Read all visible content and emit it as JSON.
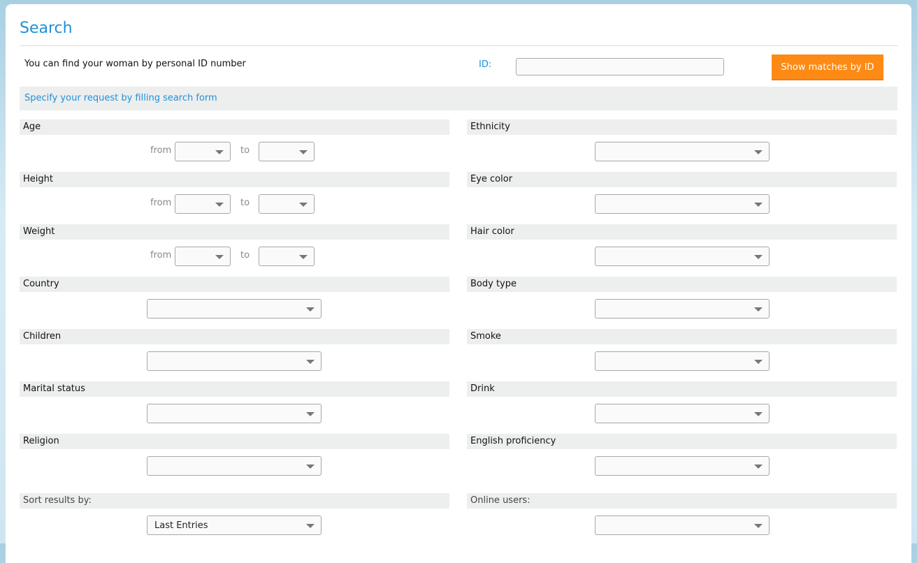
{
  "page": {
    "title": "Search"
  },
  "id_search": {
    "hint": "You can find your woman by personal ID number",
    "label": "ID:",
    "value": "",
    "placeholder": "",
    "button_label": "Show matches by ID"
  },
  "instruction": "Specify your request by filling search form",
  "range_labels": {
    "from": "from",
    "to": "to"
  },
  "left_fields": [
    {
      "label": "Age",
      "type": "range",
      "from": "",
      "to": ""
    },
    {
      "label": "Height",
      "type": "range",
      "from": "",
      "to": ""
    },
    {
      "label": "Weight",
      "type": "range",
      "from": "",
      "to": ""
    },
    {
      "label": "Country",
      "type": "select",
      "value": ""
    },
    {
      "label": "Children",
      "type": "select",
      "value": ""
    },
    {
      "label": "Marital status",
      "type": "select",
      "value": ""
    },
    {
      "label": "Religion",
      "type": "select",
      "value": ""
    }
  ],
  "right_fields": [
    {
      "label": "Ethnicity",
      "value": ""
    },
    {
      "label": "Eye color",
      "value": ""
    },
    {
      "label": "Hair color",
      "value": ""
    },
    {
      "label": "Body type",
      "value": ""
    },
    {
      "label": "Smoke",
      "value": ""
    },
    {
      "label": "Drink",
      "value": ""
    },
    {
      "label": "English proficiency",
      "value": ""
    }
  ],
  "sort": {
    "label": "Sort results by:",
    "value": "Last Entries"
  },
  "online": {
    "label": "Online users:",
    "value": ""
  },
  "colors": {
    "accent": "#1e90d8",
    "button": "#fd8a14",
    "section_bg": "#edeeee"
  }
}
